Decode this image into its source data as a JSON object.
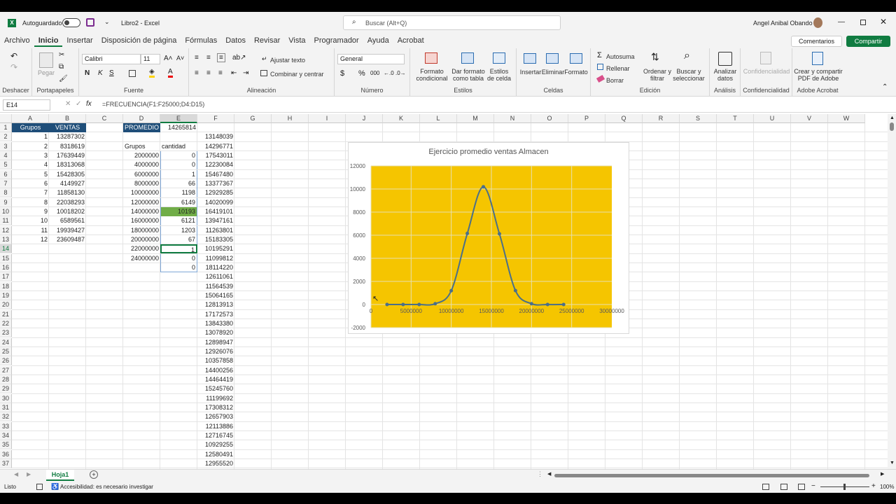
{
  "titlebar": {
    "autosave_label": "Autoguardado",
    "doc_title": "Libro2  -  Excel",
    "search_placeholder": "Buscar (Alt+Q)",
    "user_name": "Angel Anibal Obando"
  },
  "menu": {
    "items": [
      "Archivo",
      "Inicio",
      "Insertar",
      "Disposición de página",
      "Fórmulas",
      "Datos",
      "Revisar",
      "Vista",
      "Programador",
      "Ayuda",
      "Acrobat"
    ],
    "active": "Inicio",
    "comments": "Comentarios",
    "share": "Compartir"
  },
  "ribbon": {
    "undo_group": "Deshacer",
    "clipboard": {
      "paste": "Pegar",
      "label": "Portapapeles"
    },
    "font": {
      "name": "Calibri",
      "size": "11",
      "label": "Fuente"
    },
    "alignment": {
      "wrap": "Ajustar texto",
      "merge": "Combinar y centrar",
      "label": "Alineación"
    },
    "number": {
      "format": "General",
      "label": "Número"
    },
    "styles": {
      "cond": "Formato condicional",
      "table": "Dar formato como tabla",
      "cell": "Estilos de celda",
      "label": "Estilos"
    },
    "cells": {
      "insert": "Insertar",
      "delete": "Eliminar",
      "format": "Formato",
      "label": "Celdas"
    },
    "editing": {
      "autosum": "Autosuma",
      "fill": "Rellenar",
      "clear": "Borrar",
      "sort": "Ordenar y filtrar",
      "find": "Buscar y seleccionar",
      "label": "Edición"
    },
    "analysis": {
      "analyze": "Analizar datos",
      "label": "Análisis"
    },
    "sensitivity": {
      "btn": "Confidencialidad",
      "label": "Confidencialidad"
    },
    "adobe": {
      "btn": "Crear y compartir PDF de Adobe",
      "label": "Adobe Acrobat"
    }
  },
  "formula_bar": {
    "name_box": "E14",
    "formula": "=FRECUENCIA(F1:F25000;D4:D15)",
    "fx": "fx"
  },
  "columns": [
    "A",
    "B",
    "C",
    "D",
    "E",
    "F",
    "G",
    "H",
    "I",
    "J",
    "K",
    "L",
    "M",
    "N",
    "O",
    "P",
    "Q",
    "R",
    "S",
    "T",
    "U",
    "V",
    "W"
  ],
  "rows": [
    "1",
    "2",
    "3",
    "4",
    "5",
    "6",
    "7",
    "8",
    "9",
    "10",
    "11",
    "12",
    "13",
    "14",
    "15",
    "16",
    "17",
    "18",
    "19",
    "20",
    "21",
    "22",
    "23",
    "24",
    "25",
    "26",
    "27",
    "28",
    "29",
    "30",
    "31",
    "32",
    "33",
    "34",
    "35",
    "36",
    "37"
  ],
  "table_a": {
    "h1": "Grupos",
    "h2": "VENTAS",
    "groups": [
      "1",
      "2",
      "3",
      "4",
      "5",
      "6",
      "7",
      "8",
      "9",
      "10",
      "11",
      "12"
    ],
    "ventas": [
      "13287302",
      "8318619",
      "17639449",
      "18313068",
      "15428305",
      "4149927",
      "11858130",
      "22038293",
      "10018202",
      "6589561",
      "19939427",
      "23609487"
    ]
  },
  "promedio": {
    "label": "PROMEDIO",
    "value": "14265814"
  },
  "freq": {
    "h1": "Grupos",
    "h2": "cantidad",
    "bins": [
      "2000000",
      "4000000",
      "6000000",
      "8000000",
      "10000000",
      "12000000",
      "14000000",
      "16000000",
      "18000000",
      "20000000",
      "22000000",
      "24000000"
    ],
    "counts": [
      "0",
      "0",
      "1",
      "66",
      "1198",
      "6149",
      "10193",
      "6121",
      "1203",
      "67",
      "1",
      "0",
      "0"
    ]
  },
  "col_f": [
    "13148039",
    "14296771",
    "17543011",
    "12230084",
    "15467480",
    "13377367",
    "12929285",
    "14020099",
    "16419101",
    "13947161",
    "11263801",
    "15183305",
    "10195291",
    "11099812",
    "18114220",
    "12611061",
    "11564539",
    "15064165",
    "12813913",
    "17172573",
    "13843380",
    "13078920",
    "12898947",
    "12926076",
    "10357858",
    "14400256",
    "14464419",
    "15245760",
    "11199692",
    "17308312",
    "12657903",
    "12113886",
    "12716745",
    "10929255",
    "12580491",
    "12955520"
  ],
  "chart_data": {
    "type": "line",
    "title": "Ejercicio promedio ventas Almacen",
    "x": [
      2000000,
      4000000,
      6000000,
      8000000,
      10000000,
      12000000,
      14000000,
      16000000,
      18000000,
      20000000,
      22000000,
      24000000
    ],
    "series": [
      {
        "values": [
          0,
          0,
          1,
          66,
          1198,
          6149,
          10193,
          6121,
          1203,
          67,
          1,
          0
        ]
      }
    ],
    "xlim": [
      0,
      30000000
    ],
    "ylim": [
      -2000,
      12000
    ],
    "xticks": [
      "0",
      "5000000",
      "10000000",
      "15000000",
      "20000000",
      "25000000",
      "30000000"
    ],
    "yticks": [
      "-2000",
      "0",
      "2000",
      "4000",
      "6000",
      "8000",
      "10000",
      "12000"
    ],
    "plot_bg": "#f5c500",
    "line_color": "#4a6f8a",
    "grid": true,
    "smooth": true
  },
  "sheets": {
    "tabs": [
      "Hoja1"
    ],
    "active": "Hoja1"
  },
  "status": {
    "ready": "Listo",
    "accessibility": "Accesibilidad: es necesario investigar",
    "zoom": "100%"
  },
  "colors": {
    "accent": "#107c41",
    "header_fill": "#1f4e79",
    "highlight_cell": "#70ad47"
  }
}
